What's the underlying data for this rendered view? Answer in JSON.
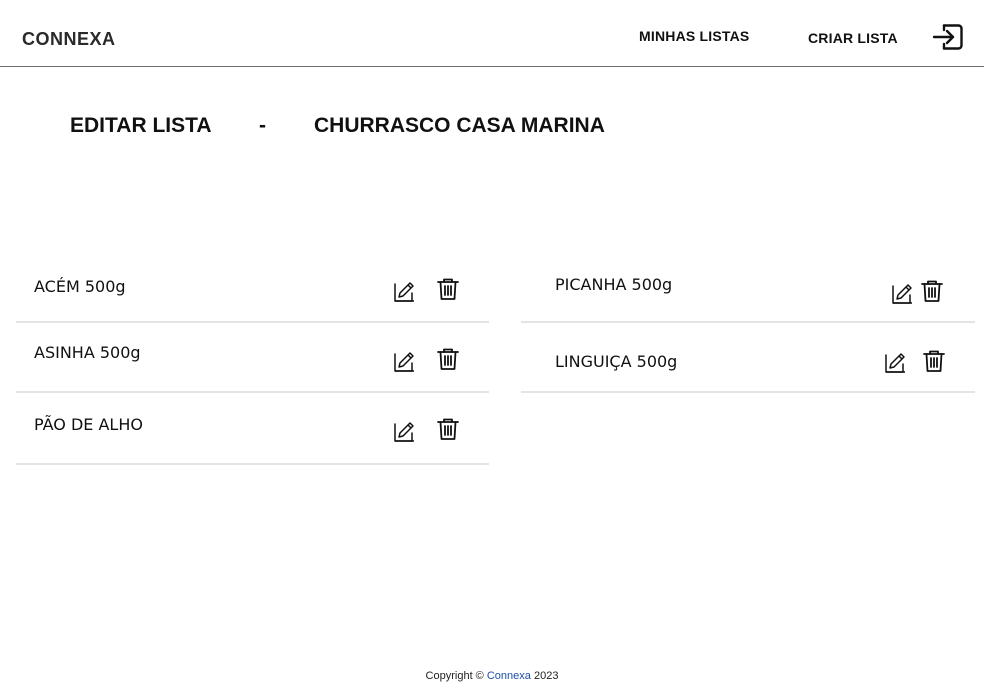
{
  "header": {
    "logo": "CONNEXA",
    "nav_my_lists": "MINHAS LISTAS",
    "nav_create_list": "CRIAR LISTA",
    "logout_icon": "logout-icon"
  },
  "title": {
    "edit_label": "EDITAR LISTA",
    "separator": "-",
    "list_name": "CHURRASCO CASA MARINA"
  },
  "items": {
    "left": [
      {
        "label": "ACÉM 500g"
      },
      {
        "label": "ASINHA 500g"
      },
      {
        "label": "PÃO DE ALHO"
      }
    ],
    "right": [
      {
        "label": "PICANHA 500g"
      },
      {
        "label": "LINGUIÇA 500g"
      }
    ]
  },
  "icons": {
    "edit": "edit-icon",
    "delete": "trash-icon"
  },
  "footer": {
    "copyright": "Copyright ©",
    "brand": "Connexa",
    "year": "2023"
  },
  "colors": {
    "divider": "#e4e4e4",
    "header_border": "#6e6e6e",
    "brand_link": "#1f4fa8"
  }
}
